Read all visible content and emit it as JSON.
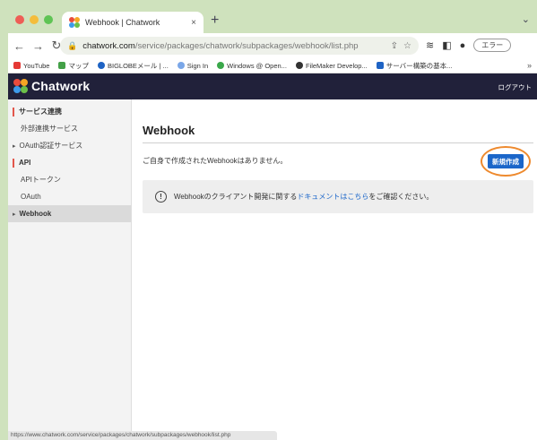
{
  "browser": {
    "tab_title": "Webhook | Chatwork",
    "tab_close": "×",
    "new_tab": "+",
    "url_host": "chatwork.com",
    "url_path": "/service/packages/chatwork/subpackages/webhook/list.php",
    "profile_label": "エラー",
    "bookmarks": [
      {
        "label": "YouTube",
        "color": "#e53935"
      },
      {
        "label": "マップ",
        "color": "#43a047"
      },
      {
        "label": "BIGLOBEメール | ...",
        "color": "#1e63c4"
      },
      {
        "label": "Sign In",
        "color": "#7aa7e8"
      },
      {
        "label": "Windows @ Open...",
        "color": "#3aa84a"
      },
      {
        "label": "FileMaker Develop...",
        "color": "#333333"
      },
      {
        "label": "サーバー構築の基本...",
        "color": "#1e63c4"
      }
    ]
  },
  "app": {
    "logo_text": "Chatwork",
    "logout_label": "ログアウト"
  },
  "sidebar": {
    "items": [
      {
        "label": "サービス連携",
        "kind": "section"
      },
      {
        "label": "外部連携サービス",
        "kind": "sub"
      },
      {
        "label": "OAuth認証サービス",
        "kind": "bullet"
      },
      {
        "label": "API",
        "kind": "section"
      },
      {
        "label": "APIトークン",
        "kind": "sub"
      },
      {
        "label": "OAuth",
        "kind": "sub"
      },
      {
        "label": "Webhook",
        "kind": "bullet-active"
      }
    ]
  },
  "main": {
    "title": "Webhook",
    "empty_message": "ご自身で作成されたWebhookはありません。",
    "create_button": "新規作成",
    "info_prefix": "Webhookのクライアント開発に関する",
    "info_link": "ドキュメントはこちら",
    "info_suffix": "をご確認ください。"
  },
  "status_url": "https://www.chatwork.com/service/packages/chatwork/subpackages/webhook/list.php",
  "colors": {
    "appbar": "#21213a",
    "primary_button": "#1b66c9",
    "highlight": "#ee8a2e",
    "section_marker": "#e2574c"
  }
}
